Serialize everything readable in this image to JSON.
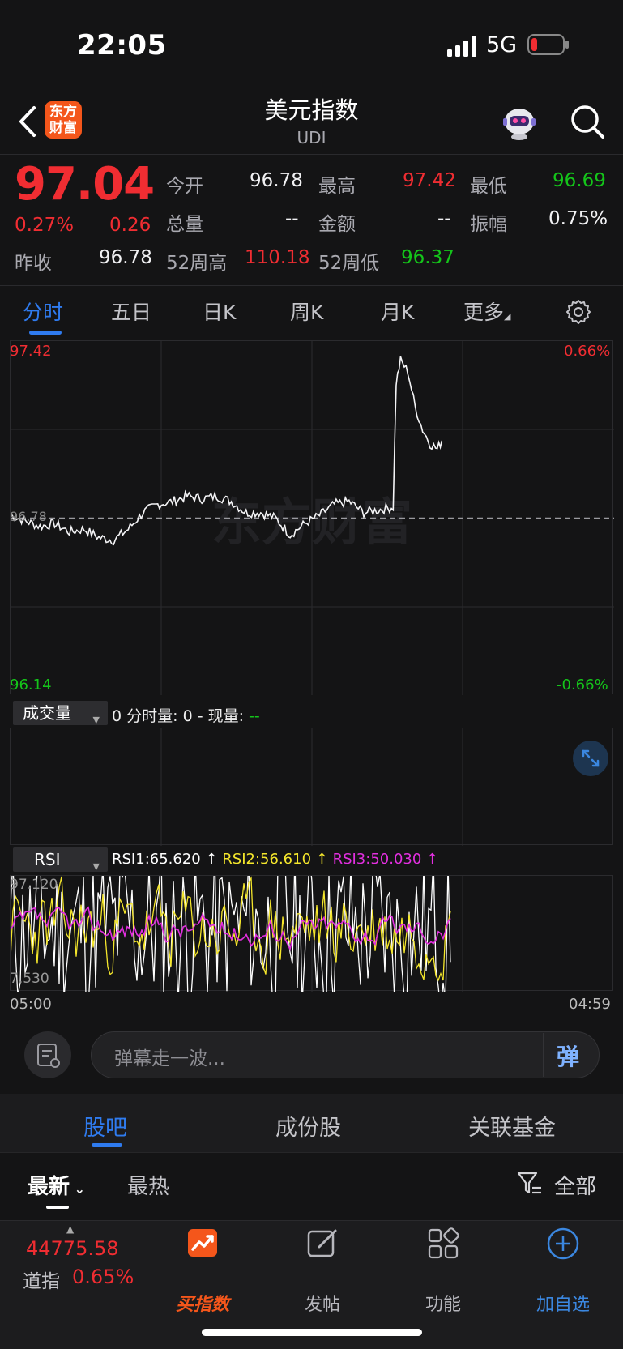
{
  "status_bar": {
    "time": "22:05",
    "network": "5G"
  },
  "header": {
    "title": "美元指数",
    "subtitle": "UDI",
    "logo_line1": "东方",
    "logo_line2": "财富"
  },
  "quote": {
    "price": "97.04",
    "change_pct": "0.27%",
    "change": "0.26",
    "prev_close_label": "昨收",
    "prev_close": "96.78",
    "open_label": "今开",
    "open": "96.78",
    "high_label": "最高",
    "high": "97.42",
    "low_label": "最低",
    "low": "96.69",
    "volume_label": "总量",
    "volume": "--",
    "amount_label": "金额",
    "amount": "--",
    "amplitude_label": "振幅",
    "amplitude": "0.75%",
    "wk52_high_label": "52周高",
    "wk52_high": "110.18",
    "wk52_low_label": "52周低",
    "wk52_low": "96.37"
  },
  "tabs": [
    "分时",
    "五日",
    "日K",
    "周K",
    "月K",
    "更多"
  ],
  "chart": {
    "ymax": "97.42",
    "ymin": "96.14",
    "pct_max": "0.66%",
    "pct_min": "-0.66%",
    "baseline": "96.78",
    "watermark": "东方财富",
    "time_start": "05:00",
    "time_end": "04:59"
  },
  "volume_panel": {
    "selector": "成交量",
    "info": "0 分时量: 0 - 现量:",
    "current": "--"
  },
  "rsi_panel": {
    "selector": "RSI",
    "rsi1": "RSI1:65.620 ↑",
    "rsi2": "RSI2:56.610 ↑",
    "rsi3": "RSI3:50.030 ↑",
    "ymax": "97.120",
    "ymin": "7.530"
  },
  "comment": {
    "placeholder": "弹幕走一波...",
    "danmu_label": "弹"
  },
  "sub_tabs": [
    "股吧",
    "成份股",
    "关联基金"
  ],
  "sort": {
    "latest": "最新",
    "hottest": "最热",
    "all": "全部"
  },
  "bottom_nav": {
    "dow_value": "44775.58",
    "dow_label": "道指",
    "dow_pct": "0.65%",
    "buy_index": "买指数",
    "post": "发帖",
    "functions": "功能",
    "add_watch": "加自选"
  },
  "chart_data": {
    "type": "line",
    "x_start": "05:00",
    "x_end": "04:59",
    "ylim": [
      96.14,
      97.42
    ],
    "baseline": 96.78,
    "series": [
      {
        "points": [
          [
            0,
            96.79
          ],
          [
            10,
            96.77
          ],
          [
            20,
            96.75
          ],
          [
            30,
            96.76
          ],
          [
            40,
            96.73
          ],
          [
            50,
            96.74
          ],
          [
            60,
            96.71
          ],
          [
            70,
            96.7
          ],
          [
            80,
            96.74
          ],
          [
            90,
            96.8
          ],
          [
            100,
            96.83
          ],
          [
            110,
            96.84
          ],
          [
            120,
            96.86
          ],
          [
            130,
            96.85
          ],
          [
            140,
            96.86
          ],
          [
            150,
            96.84
          ],
          [
            160,
            96.8
          ],
          [
            170,
            96.8
          ],
          [
            180,
            96.78
          ],
          [
            190,
            96.72
          ],
          [
            200,
            96.76
          ],
          [
            210,
            96.79
          ],
          [
            220,
            96.83
          ],
          [
            230,
            96.84
          ],
          [
            240,
            96.8
          ],
          [
            250,
            96.81
          ],
          [
            260,
            96.82
          ],
          [
            262,
            97.27
          ],
          [
            265,
            97.35
          ],
          [
            270,
            97.31
          ],
          [
            275,
            97.18
          ],
          [
            280,
            97.1
          ],
          [
            285,
            97.05
          ],
          [
            290,
            97.03
          ],
          [
            293,
            97.06
          ]
        ]
      }
    ]
  }
}
